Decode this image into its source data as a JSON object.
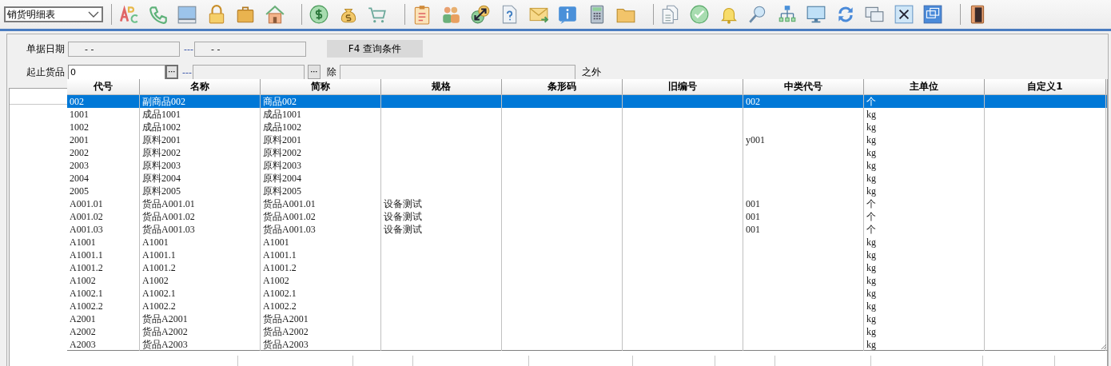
{
  "toolbar": {
    "report_select": "销货明细表"
  },
  "filters": {
    "date_label": "单据日期",
    "date_from": "- -",
    "date_sep": "---",
    "date_to": "- -",
    "query_button": "F4 查询条件",
    "goods_label": "起止货品",
    "goods_from": "0",
    "goods_sep": "---",
    "ellipsis_from": "···",
    "ellipsis_to": "···",
    "except_label": "除",
    "except_suffix": "之外"
  },
  "table": {
    "columns": [
      "代号",
      "名称",
      "简称",
      "规格",
      "条形码",
      "旧编号",
      "中类代号",
      "主单位",
      "自定义1"
    ],
    "rows": [
      {
        "code": "002",
        "name": "副商品002",
        "short_name": "商品002",
        "category_code": "002",
        "unit": "个",
        "selected": true
      },
      {
        "code": "1001",
        "name": "成品1001",
        "short_name": "成品1001",
        "unit": "kg",
        "selected": false
      },
      {
        "code": "1002",
        "name": "成品1002",
        "short_name": "成品1002",
        "unit": "kg",
        "selected": false
      },
      {
        "code": "2001",
        "name": "原料2001",
        "short_name": "原料2001",
        "category_code": "y001",
        "unit": "kg",
        "selected": false
      },
      {
        "code": "2002",
        "name": "原料2002",
        "short_name": "原料2002",
        "unit": "kg",
        "selected": false
      },
      {
        "code": "2003",
        "name": "原料2003",
        "short_name": "原料2003",
        "unit": "kg",
        "selected": false
      },
      {
        "code": "2004",
        "name": "原料2004",
        "short_name": "原料2004",
        "unit": "kg",
        "selected": false
      },
      {
        "code": "2005",
        "name": "原料2005",
        "short_name": "原料2005",
        "unit": "kg",
        "selected": false
      },
      {
        "code": "A001.01",
        "name": "货品A001.01",
        "short_name": "货品A001.01",
        "spec": "设备测试",
        "category_code": "001",
        "unit": "个",
        "selected": false
      },
      {
        "code": "A001.02",
        "name": "货品A001.02",
        "short_name": "货品A001.02",
        "spec": "设备测试",
        "category_code": "001",
        "unit": "个",
        "selected": false
      },
      {
        "code": "A001.03",
        "name": "货品A001.03",
        "short_name": "货品A001.03",
        "spec": "设备测试",
        "category_code": "001",
        "unit": "个",
        "selected": false
      },
      {
        "code": "A1001",
        "name": "A1001",
        "short_name": "A1001",
        "unit": "kg",
        "selected": false
      },
      {
        "code": "A1001.1",
        "name": "A1001.1",
        "short_name": "A1001.1",
        "unit": "kg",
        "selected": false
      },
      {
        "code": "A1001.2",
        "name": "A1001.2",
        "short_name": "A1001.2",
        "unit": "kg",
        "selected": false
      },
      {
        "code": "A1002",
        "name": "A1002",
        "short_name": "A1002",
        "unit": "kg",
        "selected": false
      },
      {
        "code": "A1002.1",
        "name": "A1002.1",
        "short_name": "A1002.1",
        "unit": "kg",
        "selected": false
      },
      {
        "code": "A1002.2",
        "name": "A1002.2",
        "short_name": "A1002.2",
        "unit": "kg",
        "selected": false
      },
      {
        "code": "A2001",
        "name": "货品A2001",
        "short_name": "货品A2001",
        "unit": "kg",
        "selected": false
      },
      {
        "code": "A2002",
        "name": "货品A2002",
        "short_name": "货品A2002",
        "unit": "kg",
        "selected": false
      },
      {
        "code": "A2003",
        "name": "货品A2003",
        "short_name": "货品A2003",
        "unit": "kg",
        "selected": false
      }
    ]
  }
}
